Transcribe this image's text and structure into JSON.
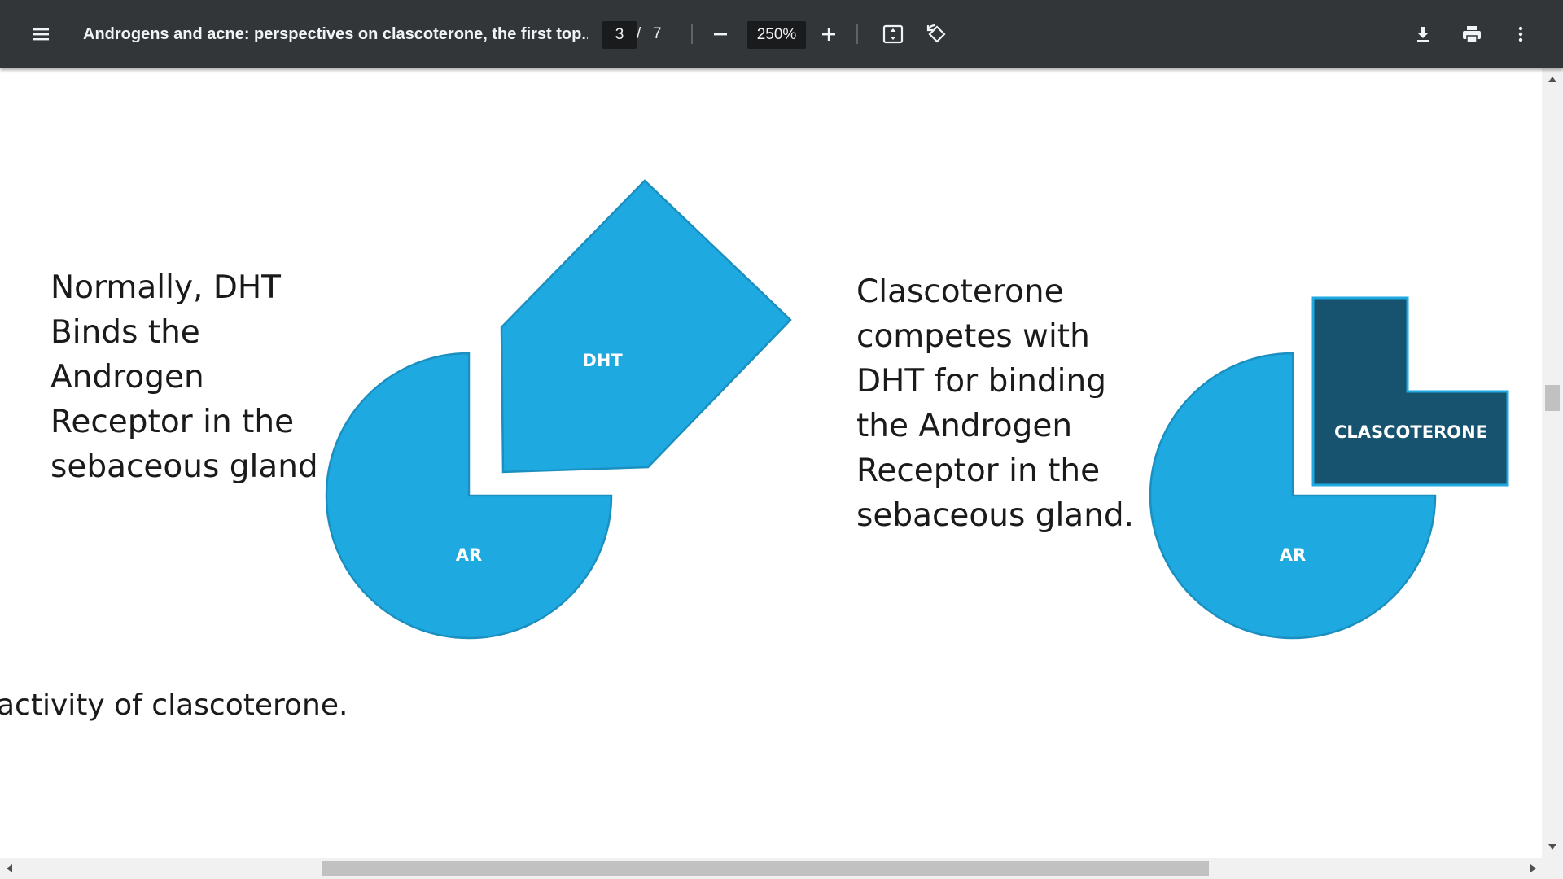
{
  "toolbar": {
    "menu_icon": "hamburger-menu-icon",
    "title": "Androgens and acne: perspectives on clascoterone, the first top...",
    "current_page": "3",
    "page_separator": "/",
    "total_pages": "7",
    "zoom_out_icon": "minus-icon",
    "zoom_value": "250%",
    "zoom_in_icon": "plus-icon",
    "fit_icon": "fit-to-page-icon",
    "rotate_icon": "rotate-icon",
    "download_icon": "download-icon",
    "print_icon": "print-icon",
    "more_icon": "more-vertical-icon",
    "background_color": "#323639"
  },
  "document": {
    "left_text": [
      "Normally, DHT",
      "Binds the",
      "Androgen",
      "Receptor in the",
      "sebaceous gland"
    ],
    "right_text": [
      "Clascoterone",
      "competes with",
      "DHT for binding",
      "the Androgen",
      "Receptor in the",
      "sebaceous gland."
    ],
    "dht_label": "DHT",
    "ar_label_left": "AR",
    "ar_label_right": "AR",
    "clascoterone_label": "CLASCOTERONE",
    "bottom_text": "activity of clascoterone.",
    "colors": {
      "shape_blue": "#1eaae1",
      "shape_blue_outline": "#1a8fc0",
      "clascoterone_dark": "#17536e"
    }
  }
}
